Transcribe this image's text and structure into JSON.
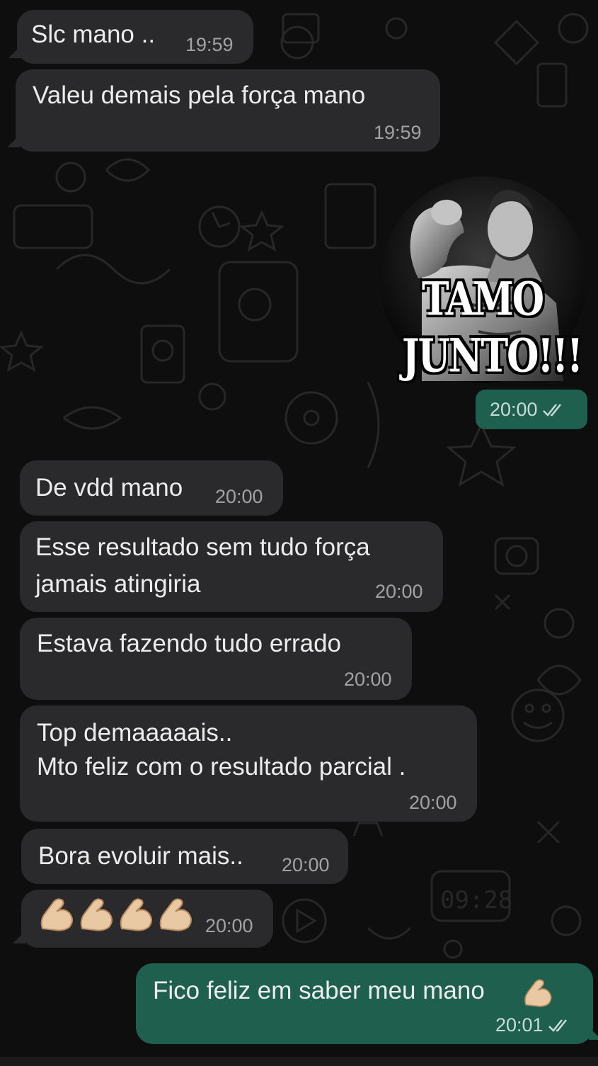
{
  "messages": [
    {
      "id": "m1",
      "text": "Slc mano ..",
      "time": "19:59"
    },
    {
      "id": "m2",
      "text": "Valeu demais pela força mano",
      "time": "19:59"
    },
    {
      "id": "m3",
      "sticker_line1": "TAMO",
      "sticker_line2": "JUNTO!!!",
      "time": "20:00",
      "status": "read"
    },
    {
      "id": "m4",
      "text": "De vdd mano",
      "time": "20:00"
    },
    {
      "id": "m5",
      "line1": "Esse resultado sem tudo força",
      "line2": "jamais atingiria",
      "time": "20:00"
    },
    {
      "id": "m6",
      "text": "Estava fazendo tudo errado",
      "time": "20:00"
    },
    {
      "id": "m7",
      "line1": "Top demaaaaais..",
      "line2": "Mto feliz com o resultado parcial .",
      "time": "20:00"
    },
    {
      "id": "m8",
      "text": "Bora evoluir mais..",
      "time": "20:00"
    },
    {
      "id": "m9",
      "emoji_count": 4,
      "emoji_name": "flexed-biceps-icon",
      "time": "20:00"
    },
    {
      "id": "m10",
      "text": "Fico feliz em saber meu mano",
      "time": "20:01",
      "status": "read"
    }
  ],
  "wallpaper": {
    "clock_text": "09:28"
  },
  "colors": {
    "background": "#0e0e0f",
    "incoming_bubble": "#2a2a2c",
    "outgoing_bubble": "#1f5f4e",
    "text": "#ececec",
    "timestamp": "#a2a2a2"
  }
}
